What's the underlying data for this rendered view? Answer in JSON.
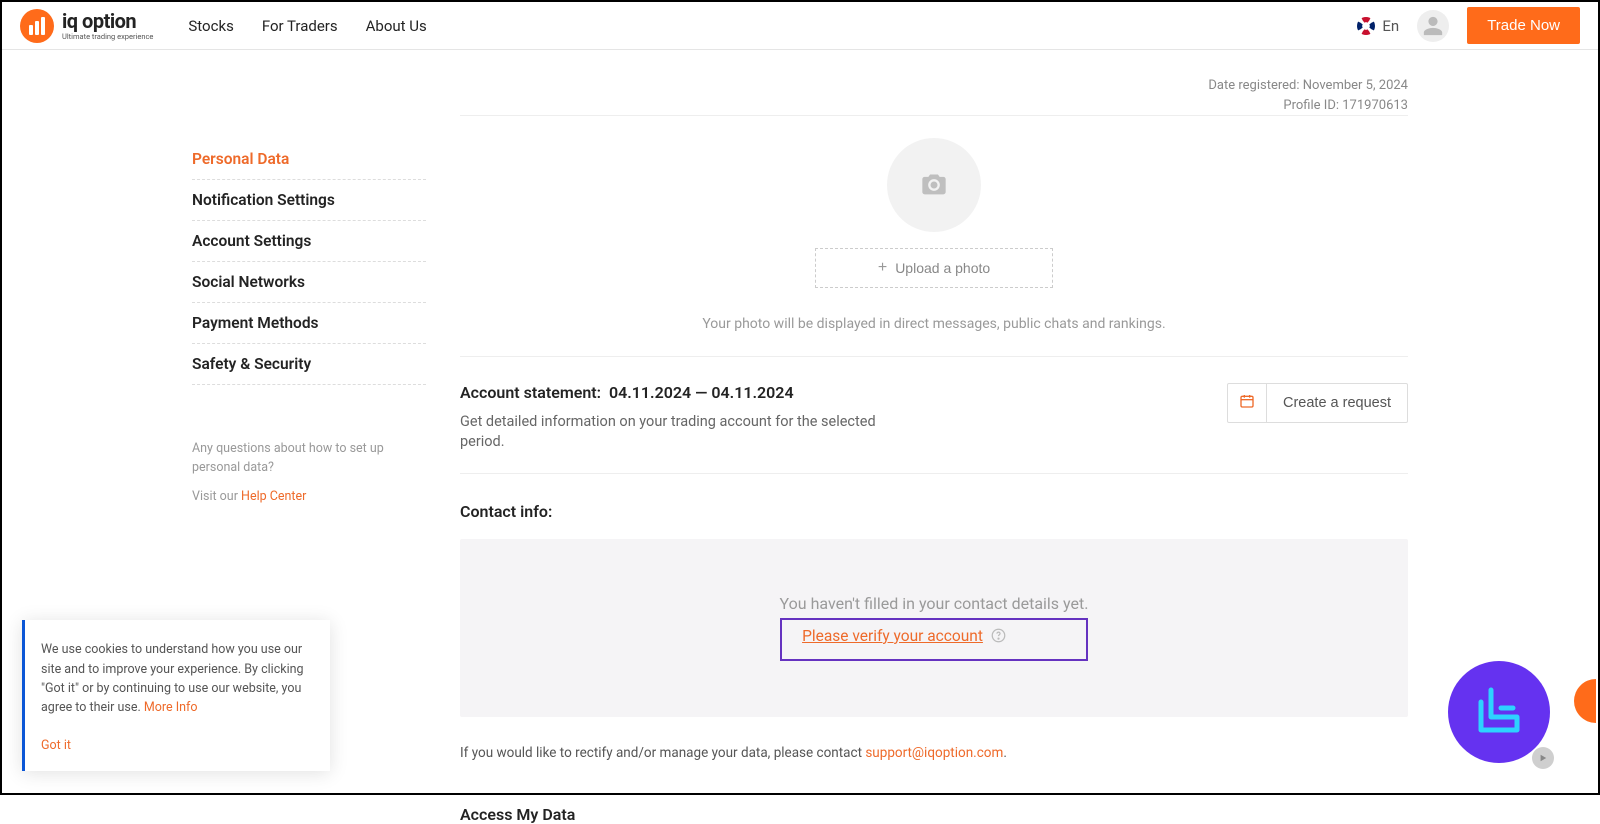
{
  "header": {
    "logo_title": "iq option",
    "logo_tagline": "Ultimate trading experience",
    "nav": [
      "Stocks",
      "For Traders",
      "About Us"
    ],
    "lang": "En",
    "trade_now": "Trade Now"
  },
  "meta": {
    "registered_label": "Date registered:",
    "registered_value": "November 5, 2024",
    "profile_label": "Profile ID:",
    "profile_value": "171970613"
  },
  "sidebar": {
    "items": [
      "Personal Data",
      "Notification Settings",
      "Account Settings",
      "Social Networks",
      "Payment Methods",
      "Safety & Security"
    ],
    "help_text": "Any questions about how to set up personal data?",
    "visit_label": "Visit our ",
    "help_center": "Help Center"
  },
  "photo": {
    "upload_label": "Upload a photo",
    "note": "Your photo will be displayed in direct messages, public chats and rankings."
  },
  "statement": {
    "title": "Account statement:",
    "date_range": "04.11.2024 — 04.11.2024",
    "desc": "Get detailed information on your trading account for the selected period.",
    "create_request": "Create a request"
  },
  "contact": {
    "title": "Contact info:",
    "not_filled": "You haven't filled in your contact details yet.",
    "verify": "Please verify your account",
    "rectify_prefix": "If you would like to rectify and/or manage your data, please contact ",
    "support_email": "support@iqoption.com"
  },
  "access": {
    "title": "Access My Data"
  },
  "cookie": {
    "text": "We use cookies to understand how you use our site and to improve your experience. By clicking \"Got it\" or by continuing to use our website, you agree to their use. ",
    "more": "More Info",
    "gotit": "Got it"
  }
}
